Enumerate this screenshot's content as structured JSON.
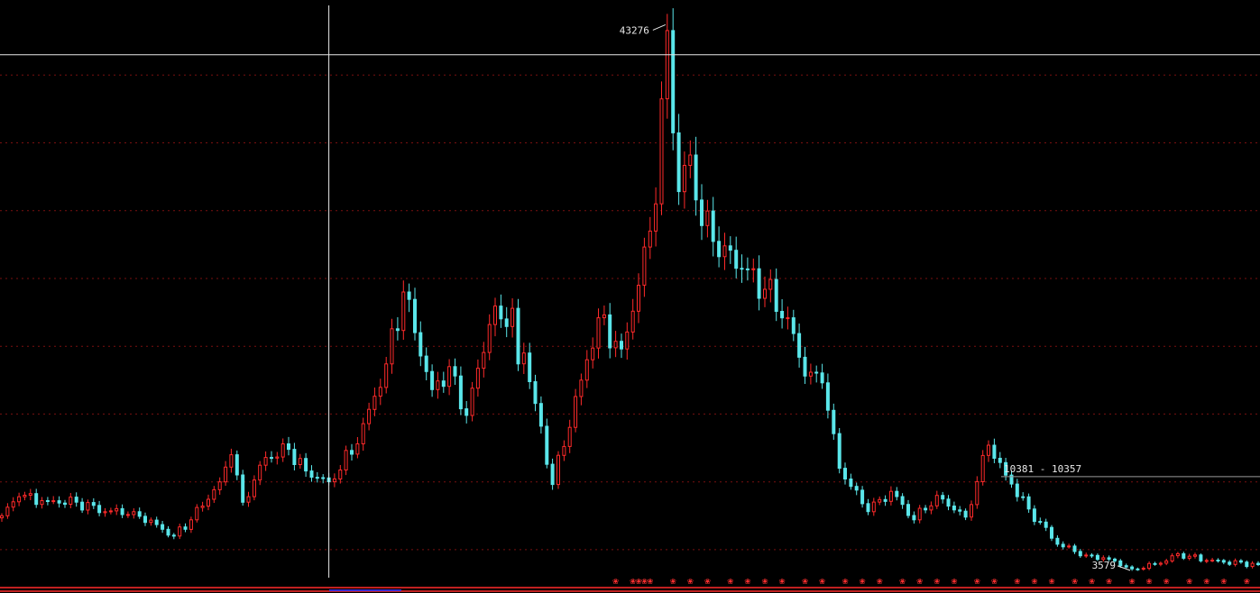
{
  "chart_data": {
    "type": "candlestick",
    "title": "",
    "xlabel": "",
    "ylabel": "",
    "ylim": [
      3000,
      45000
    ],
    "grid": true,
    "gridline_values": [
      5000,
      10000,
      15000,
      20000,
      25000,
      30000,
      35000,
      40000
    ],
    "annotations": {
      "high_label": "43276",
      "low_label": "3579",
      "price_label": "10381 - 10357",
      "price_level": 10381
    },
    "crosshair": {
      "vertical_bar": 57,
      "horizontal_value": 41500
    },
    "event_marker": "❀",
    "waypoints": [
      [
        0,
        7500
      ],
      [
        3,
        8900
      ],
      [
        8,
        8600
      ],
      [
        13,
        8500
      ],
      [
        18,
        7800
      ],
      [
        23,
        7800
      ],
      [
        28,
        6500
      ],
      [
        30,
        6000
      ],
      [
        33,
        7200
      ],
      [
        38,
        10000
      ],
      [
        40,
        12000
      ],
      [
        42,
        8500
      ],
      [
        46,
        11800
      ],
      [
        50,
        12400
      ],
      [
        53,
        10800
      ],
      [
        57,
        10000
      ],
      [
        62,
        12800
      ],
      [
        67,
        18700
      ],
      [
        70,
        24000
      ],
      [
        72,
        21000
      ],
      [
        75,
        16800
      ],
      [
        78,
        18500
      ],
      [
        81,
        14900
      ],
      [
        85,
        21600
      ],
      [
        89,
        22800
      ],
      [
        90,
        18700
      ],
      [
        91,
        19500
      ],
      [
        96,
        9800
      ],
      [
        101,
        17500
      ],
      [
        104,
        22100
      ],
      [
        108,
        19800
      ],
      [
        111,
        24500
      ],
      [
        114,
        30500
      ],
      [
        116,
        43276
      ],
      [
        118,
        31400
      ],
      [
        120,
        34100
      ],
      [
        122,
        28900
      ],
      [
        126,
        27400
      ],
      [
        129,
        25700
      ],
      [
        133,
        24200
      ],
      [
        137,
        22100
      ],
      [
        140,
        17800
      ],
      [
        143,
        17300
      ],
      [
        146,
        11000
      ],
      [
        151,
        7800
      ],
      [
        155,
        9300
      ],
      [
        159,
        7200
      ],
      [
        163,
        9000
      ],
      [
        168,
        7400
      ],
      [
        172,
        12700
      ],
      [
        175,
        10500
      ],
      [
        179,
        8000
      ],
      [
        184,
        5400
      ],
      [
        189,
        4600
      ],
      [
        193,
        4300
      ],
      [
        197,
        3579
      ],
      [
        202,
        4000
      ],
      [
        205,
        4700
      ],
      [
        210,
        4200
      ],
      [
        219,
        3900
      ]
    ],
    "event_marker_bars": [
      107,
      110,
      111,
      112,
      113,
      117,
      120,
      123,
      127,
      130,
      133,
      136,
      140,
      143,
      147,
      150,
      153,
      157,
      160,
      163,
      166,
      170,
      173,
      177,
      180,
      183,
      187,
      190,
      193,
      197,
      200,
      203,
      207,
      210,
      213,
      217
    ]
  }
}
